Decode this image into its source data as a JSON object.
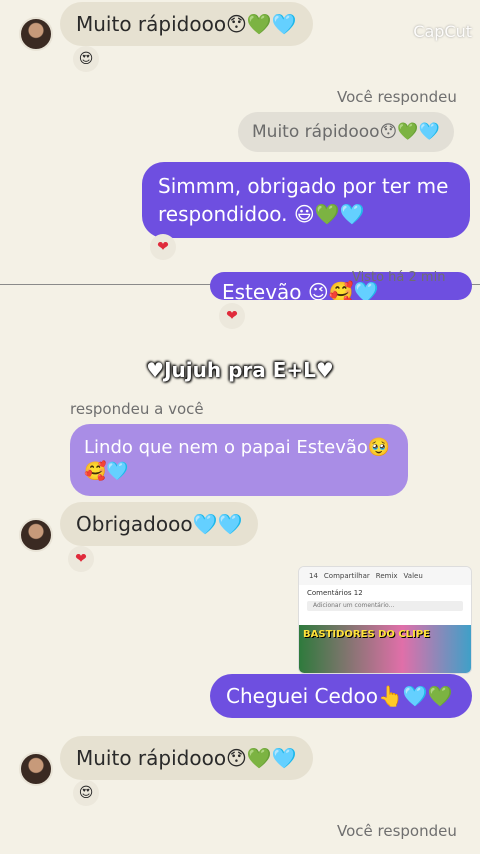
{
  "watermark": "CapCut",
  "overlay_title": "♥Jujuh pra E+L♥",
  "messages": {
    "m1": "Muito rápidooo😯💚🩵",
    "m1_reaction": "😍",
    "reply_label_1": "Você respondeu",
    "quote_1": "Muito rápidooo😯💚🩵",
    "out_1": "Simmm, obrigado por ter me respondidoo. 😃💚🩵",
    "out_1_reaction": "❤",
    "partial_out": "Estevão 😉🥰🩵",
    "seen_label": "Visto há 2 min",
    "partial_reaction": "❤",
    "reply_label_2": "respondeu a você",
    "quote_2": "Lindo que nem o papai Estevão🥹🥰🩵",
    "m2": "Obrigadooo🩵🩵",
    "m2_reaction": "❤",
    "out_2": "Cheguei Cedoo👆🩵💚",
    "m3": "Muito rápidooo😯💚🩵",
    "m3_reaction": "😍",
    "reply_label_3": "Você respondeu"
  },
  "post_preview": {
    "likes": "14",
    "comments_count": "12",
    "share": "Compartilhar",
    "remix": "Remix",
    "save": "Valeu",
    "comments_label": "Comentários",
    "add_comment": "Adicionar um comentário...",
    "image_caption": "BASTIDORES DO CLIPE"
  },
  "colors": {
    "background": "#f4f1e6",
    "outgoing_bubble": "#6e4fe0",
    "quote_bubble": "#a98de6",
    "incoming_bubble": "#e6e1d1"
  }
}
